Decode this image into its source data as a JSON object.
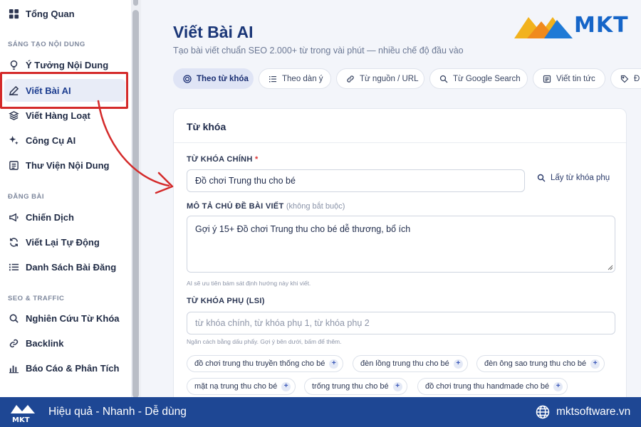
{
  "sidebar": {
    "items": [
      {
        "label": "Tổng Quan"
      },
      {
        "label": "Ý Tưởng Nội Dung"
      },
      {
        "label": "Viết Bài AI"
      },
      {
        "label": "Viết Hàng Loạt"
      },
      {
        "label": "Công Cụ AI"
      },
      {
        "label": "Thư Viện Nội Dung"
      },
      {
        "label": "Chiến Dịch"
      },
      {
        "label": "Viết Lại Tự Động"
      },
      {
        "label": "Danh Sách Bài Đăng"
      },
      {
        "label": "Nghiên Cứu Từ Khóa"
      },
      {
        "label": "Backlink"
      },
      {
        "label": "Báo Cáo & Phân Tích"
      }
    ],
    "sections": [
      "SÁNG TẠO NỘI DUNG",
      "ĐĂNG BÀI",
      "SEO & TRAFFIC"
    ]
  },
  "header": {
    "title": "Viết Bài AI",
    "subtitle": "Tạo bài viết chuẩn SEO 2.000+ từ trong vài phút — nhiều chế độ đầu vào",
    "brand": "MKT"
  },
  "tabs": [
    {
      "label": "Theo từ khóa",
      "icon": "target-icon"
    },
    {
      "label": "Theo dàn ý",
      "icon": "list-icon"
    },
    {
      "label": "Từ nguồn / URL",
      "icon": "link-icon"
    },
    {
      "label": "Từ Google Search",
      "icon": "search-icon"
    },
    {
      "label": "Viết tin tức",
      "icon": "news-icon"
    },
    {
      "label": "Đ",
      "icon": "tag-icon"
    }
  ],
  "card": {
    "title": "Từ khóa",
    "main_keyword": {
      "label": "TỪ KHÓA CHÍNH",
      "required_mark": "*",
      "value": "Đồ chơi Trung thu cho bé"
    },
    "lsi_link": "Lấy từ khóa phụ",
    "description": {
      "label": "MÔ TẢ CHỦ ĐỀ BÀI VIẾT",
      "optional": "(không bắt buộc)",
      "value": "Gợi ý 15+ Đồ chơi Trung thu cho bé dễ thương, bổ ích",
      "hint": "AI sẽ ưu tiên bám sát định hướng này khi viết."
    },
    "lsi": {
      "label": "TỪ KHÓA PHỤ (LSI)",
      "placeholder": "từ khóa chính, từ khóa phụ 1, từ khóa phụ 2",
      "hint": "Ngăn cách bằng dấu phẩy. Gợi ý bên dưới, bấm để thêm."
    },
    "suggestions": [
      "đồ chơi trung thu truyền thống cho bé",
      "đèn lồng trung thu cho bé",
      "đèn ông sao trung thu cho bé",
      "mặt nạ trung thu cho bé",
      "trống trung thu cho bé",
      "đồ chơi trung thu handmade cho bé"
    ],
    "plus_glyph": "+"
  },
  "footer": {
    "tagline": "Hiệu quả - Nhanh - Dễ dùng",
    "website": "mktsoftware.vn",
    "logo_text": "MKT"
  },
  "colors": {
    "accent": "#1a3677",
    "footer_bg": "#1e4794",
    "highlight": "#d42a2a"
  }
}
